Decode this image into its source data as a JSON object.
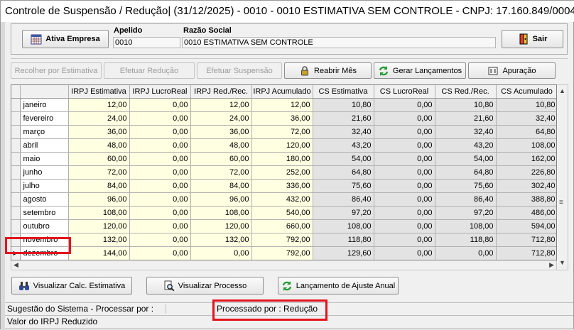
{
  "window": {
    "title": "Controle de Suspensão / Redução| (31/12/2025) - 0010 - 0010 ESTIMATIVA SEM CONTROLE  - CNPJ: 17.160.849/0004-..."
  },
  "header": {
    "ativa_empresa_label": "Ativa Empresa",
    "apelido_label": "Apelido",
    "apelido_value": "0010",
    "razao_label": "Razão Social",
    "razao_value": "0010 ESTIMATIVA SEM CONTROLE",
    "sair_label": "Sair"
  },
  "toolbar": {
    "recolher": "Recolher por Estimativa",
    "efetuar_reducao": "Efetuar Redução",
    "efetuar_suspensao": "Efetuar Suspensão",
    "reabrir_mes": "Reabrir Mês",
    "gerar_lancamentos": "Gerar Lançamentos",
    "apuracao": "Apuração"
  },
  "grid": {
    "columns": [
      "",
      "",
      "IRPJ Estimativa",
      "IRPJ LucroReal",
      "IRPJ Red./Rec.",
      "IRPJ Acumulado",
      "CS Estimativa",
      "CS LucroReal",
      "CS Red./Rec.",
      "CS Acumulado"
    ],
    "rows": [
      {
        "mes": "janeiro",
        "v": [
          "12,00",
          "0,00",
          "12,00",
          "12,00",
          "10,80",
          "0,00",
          "10,80",
          "10,80"
        ]
      },
      {
        "mes": "fevereiro",
        "v": [
          "24,00",
          "0,00",
          "24,00",
          "36,00",
          "21,60",
          "0,00",
          "21,60",
          "32,40"
        ]
      },
      {
        "mes": "março",
        "v": [
          "36,00",
          "0,00",
          "36,00",
          "72,00",
          "32,40",
          "0,00",
          "32,40",
          "64,80"
        ]
      },
      {
        "mes": "abril",
        "v": [
          "48,00",
          "0,00",
          "48,00",
          "120,00",
          "43,20",
          "0,00",
          "43,20",
          "108,00"
        ]
      },
      {
        "mes": "maio",
        "v": [
          "60,00",
          "0,00",
          "60,00",
          "180,00",
          "54,00",
          "0,00",
          "54,00",
          "162,00"
        ]
      },
      {
        "mes": "junho",
        "v": [
          "72,00",
          "0,00",
          "72,00",
          "252,00",
          "64,80",
          "0,00",
          "64,80",
          "226,80"
        ]
      },
      {
        "mes": "julho",
        "v": [
          "84,00",
          "0,00",
          "84,00",
          "336,00",
          "75,60",
          "0,00",
          "75,60",
          "302,40"
        ]
      },
      {
        "mes": "agosto",
        "v": [
          "96,00",
          "0,00",
          "96,00",
          "432,00",
          "86,40",
          "0,00",
          "86,40",
          "388,80"
        ]
      },
      {
        "mes": "setembro",
        "v": [
          "108,00",
          "0,00",
          "108,00",
          "540,00",
          "97,20",
          "0,00",
          "97,20",
          "486,00"
        ]
      },
      {
        "mes": "outubro",
        "v": [
          "120,00",
          "0,00",
          "120,00",
          "660,00",
          "108,00",
          "0,00",
          "108,00",
          "594,00"
        ]
      },
      {
        "mes": "novembro",
        "v": [
          "132,00",
          "0,00",
          "132,00",
          "792,00",
          "118,80",
          "0,00",
          "118,80",
          "712,80"
        ]
      },
      {
        "mes": "dezembro",
        "v": [
          "144,00",
          "0,00",
          "0,00",
          "792,00",
          "129,60",
          "0,00",
          "0,00",
          "712,80"
        ]
      }
    ],
    "selected_row": 11
  },
  "bottom_buttons": {
    "visualizar_calc": "Visualizar Calc. Estimativa",
    "visualizar_processo": "Visualizar Processo",
    "lancamento_ajuste": "Lançamento de Ajuste Anual"
  },
  "status": {
    "sugestao": "Sugestão do Sistema - Processar por :",
    "processado": "Processado por : Redução",
    "valor_irpj": "Valor do IRPJ Reduzido"
  },
  "colors": {
    "highlight": "#e3141e",
    "yellow_cell": "#ffffe1",
    "gray_cell": "#e3e3e3"
  },
  "icons": [
    "calendar-grid-icon",
    "exit-door-icon",
    "padlock-icon",
    "refresh-arrows-icon",
    "report-icon",
    "binoculars-icon",
    "magnifier-document-icon"
  ]
}
